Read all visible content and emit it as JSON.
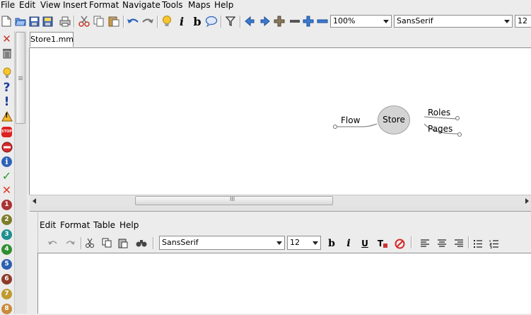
{
  "menubar": {
    "items": [
      "File",
      "Edit",
      "View",
      "Insert",
      "Format",
      "Navigate",
      "Tools",
      "Maps",
      "Help"
    ]
  },
  "toolbar": {
    "icons": [
      "new-document-icon",
      "open-folder-icon",
      "save-icon",
      "save-as-icon",
      "print-icon",
      "cut-icon",
      "copy-icon",
      "paste-icon",
      "undo-icon",
      "redo-icon",
      "lightbulb-icon",
      "italic-icon",
      "bold-icon",
      "cloud-icon",
      "filter-icon",
      "back-icon",
      "forward-icon",
      "expand-icon",
      "collapse-icon",
      "zoom-in-icon",
      "zoom-out-icon"
    ],
    "italic_label": "i",
    "bold_label": "b",
    "zoom_value": "100%",
    "font_value": "SansSerif",
    "size_value": "12"
  },
  "tabs": [
    {
      "label": "Store1.mm"
    }
  ],
  "mindmap": {
    "root": "Store",
    "left_children": [
      "Flow"
    ],
    "right_children": [
      "Roles",
      "Pages"
    ],
    "colors": {
      "root_fill": "#d4d4d4",
      "root_border": "#a4a4a4",
      "edge": "#707070"
    }
  },
  "scrollbar": {
    "grip": "III"
  },
  "left_icons": [
    "delete-icon",
    "trash-icon",
    "idea-icon",
    "question-icon",
    "exclamation-icon",
    "warning-icon",
    "stop-icon",
    "no-entry-icon",
    "info-icon",
    "check-icon",
    "cross-icon",
    "priority-1-icon",
    "priority-2-icon",
    "priority-3-icon",
    "priority-4-icon",
    "priority-5-icon",
    "priority-6-icon",
    "priority-7-icon",
    "priority-8-icon"
  ],
  "left_icon_glyphs": {
    "question": "?",
    "exclamation": "!",
    "warning": "!",
    "stop": "STOP",
    "info": "i",
    "check": "✓",
    "cross": "✕",
    "delete": "✕"
  },
  "priorities": [
    {
      "label": "1",
      "color": "#a33"
    },
    {
      "label": "2",
      "color": "#7d7d2a"
    },
    {
      "label": "3",
      "color": "#1e8f8f"
    },
    {
      "label": "4",
      "color": "#2f8f2f"
    },
    {
      "label": "5",
      "color": "#2c5fb0"
    },
    {
      "label": "6",
      "color": "#8e3b2a"
    },
    {
      "label": "7",
      "color": "#c09a2f"
    },
    {
      "label": "8",
      "color": "#c98a3a"
    }
  ],
  "editor": {
    "menu": [
      "Edit",
      "Format",
      "Table",
      "Help"
    ],
    "font_value": "SansSerif",
    "size_value": "12",
    "bold_label": "b",
    "italic_label": "i",
    "underline_label": "U",
    "clear_format_label": "T",
    "icons": [
      "undo-icon",
      "redo-icon",
      "cut-icon",
      "copy-icon",
      "paste-icon",
      "find-icon",
      "bold-icon",
      "italic-icon",
      "underline-icon",
      "clear-format-icon",
      "no-format-icon",
      "align-left-icon",
      "align-center-icon",
      "align-right-icon",
      "bullet-list-icon",
      "numbered-list-icon"
    ]
  }
}
